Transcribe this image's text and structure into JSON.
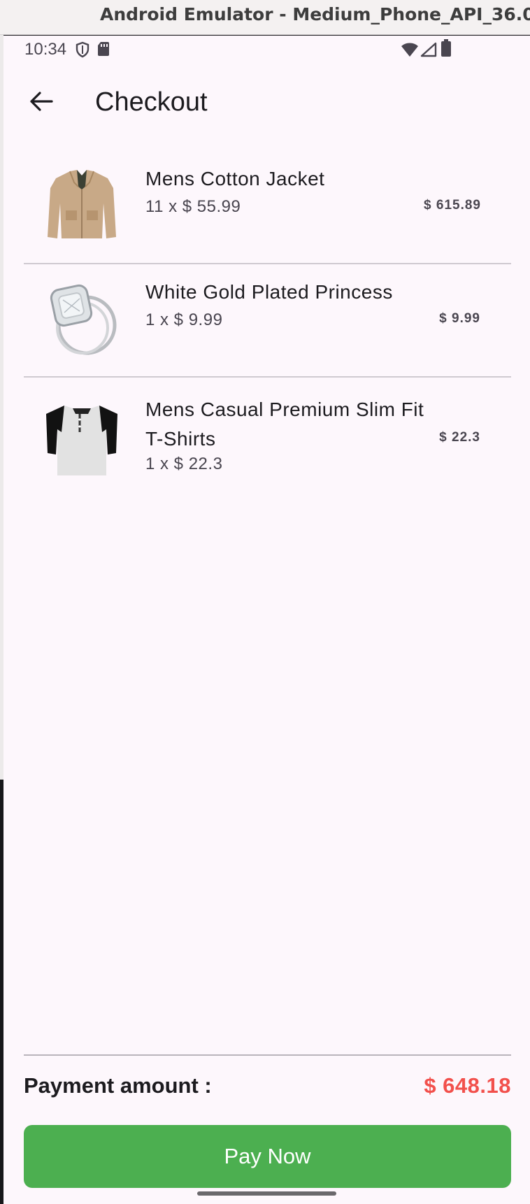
{
  "window": {
    "title": "Android Emulator - Medium_Phone_API_36.0..."
  },
  "statusbar": {
    "time": "10:34",
    "icons": [
      "shield-icon",
      "sim-card-icon",
      "wifi-icon",
      "cellular-signal-icon",
      "battery-icon"
    ]
  },
  "appbar": {
    "back_icon": "arrow-back-icon",
    "title": "Checkout"
  },
  "cart": {
    "items": [
      {
        "name": "Mens Cotton Jacket",
        "qty_price": "11 x $ 55.99",
        "total": "$ 615.89",
        "image": "jacket"
      },
      {
        "name": "White Gold Plated Princess",
        "qty_price": "1 x $ 9.99",
        "total": "$ 9.99",
        "image": "ring"
      },
      {
        "name": "Mens Casual Premium Slim Fit T-Shirts",
        "qty_price": "1 x $ 22.3",
        "total": "$ 22.3",
        "image": "tshirt"
      }
    ]
  },
  "footer": {
    "payment_label": "Payment amount :",
    "payment_amount": "$ 648.18",
    "pay_button": "Pay Now"
  },
  "colors": {
    "background": "#fdf7fc",
    "accent_green": "#4caf50",
    "amount_red": "#f2504c",
    "text": "#1c1b1f"
  }
}
